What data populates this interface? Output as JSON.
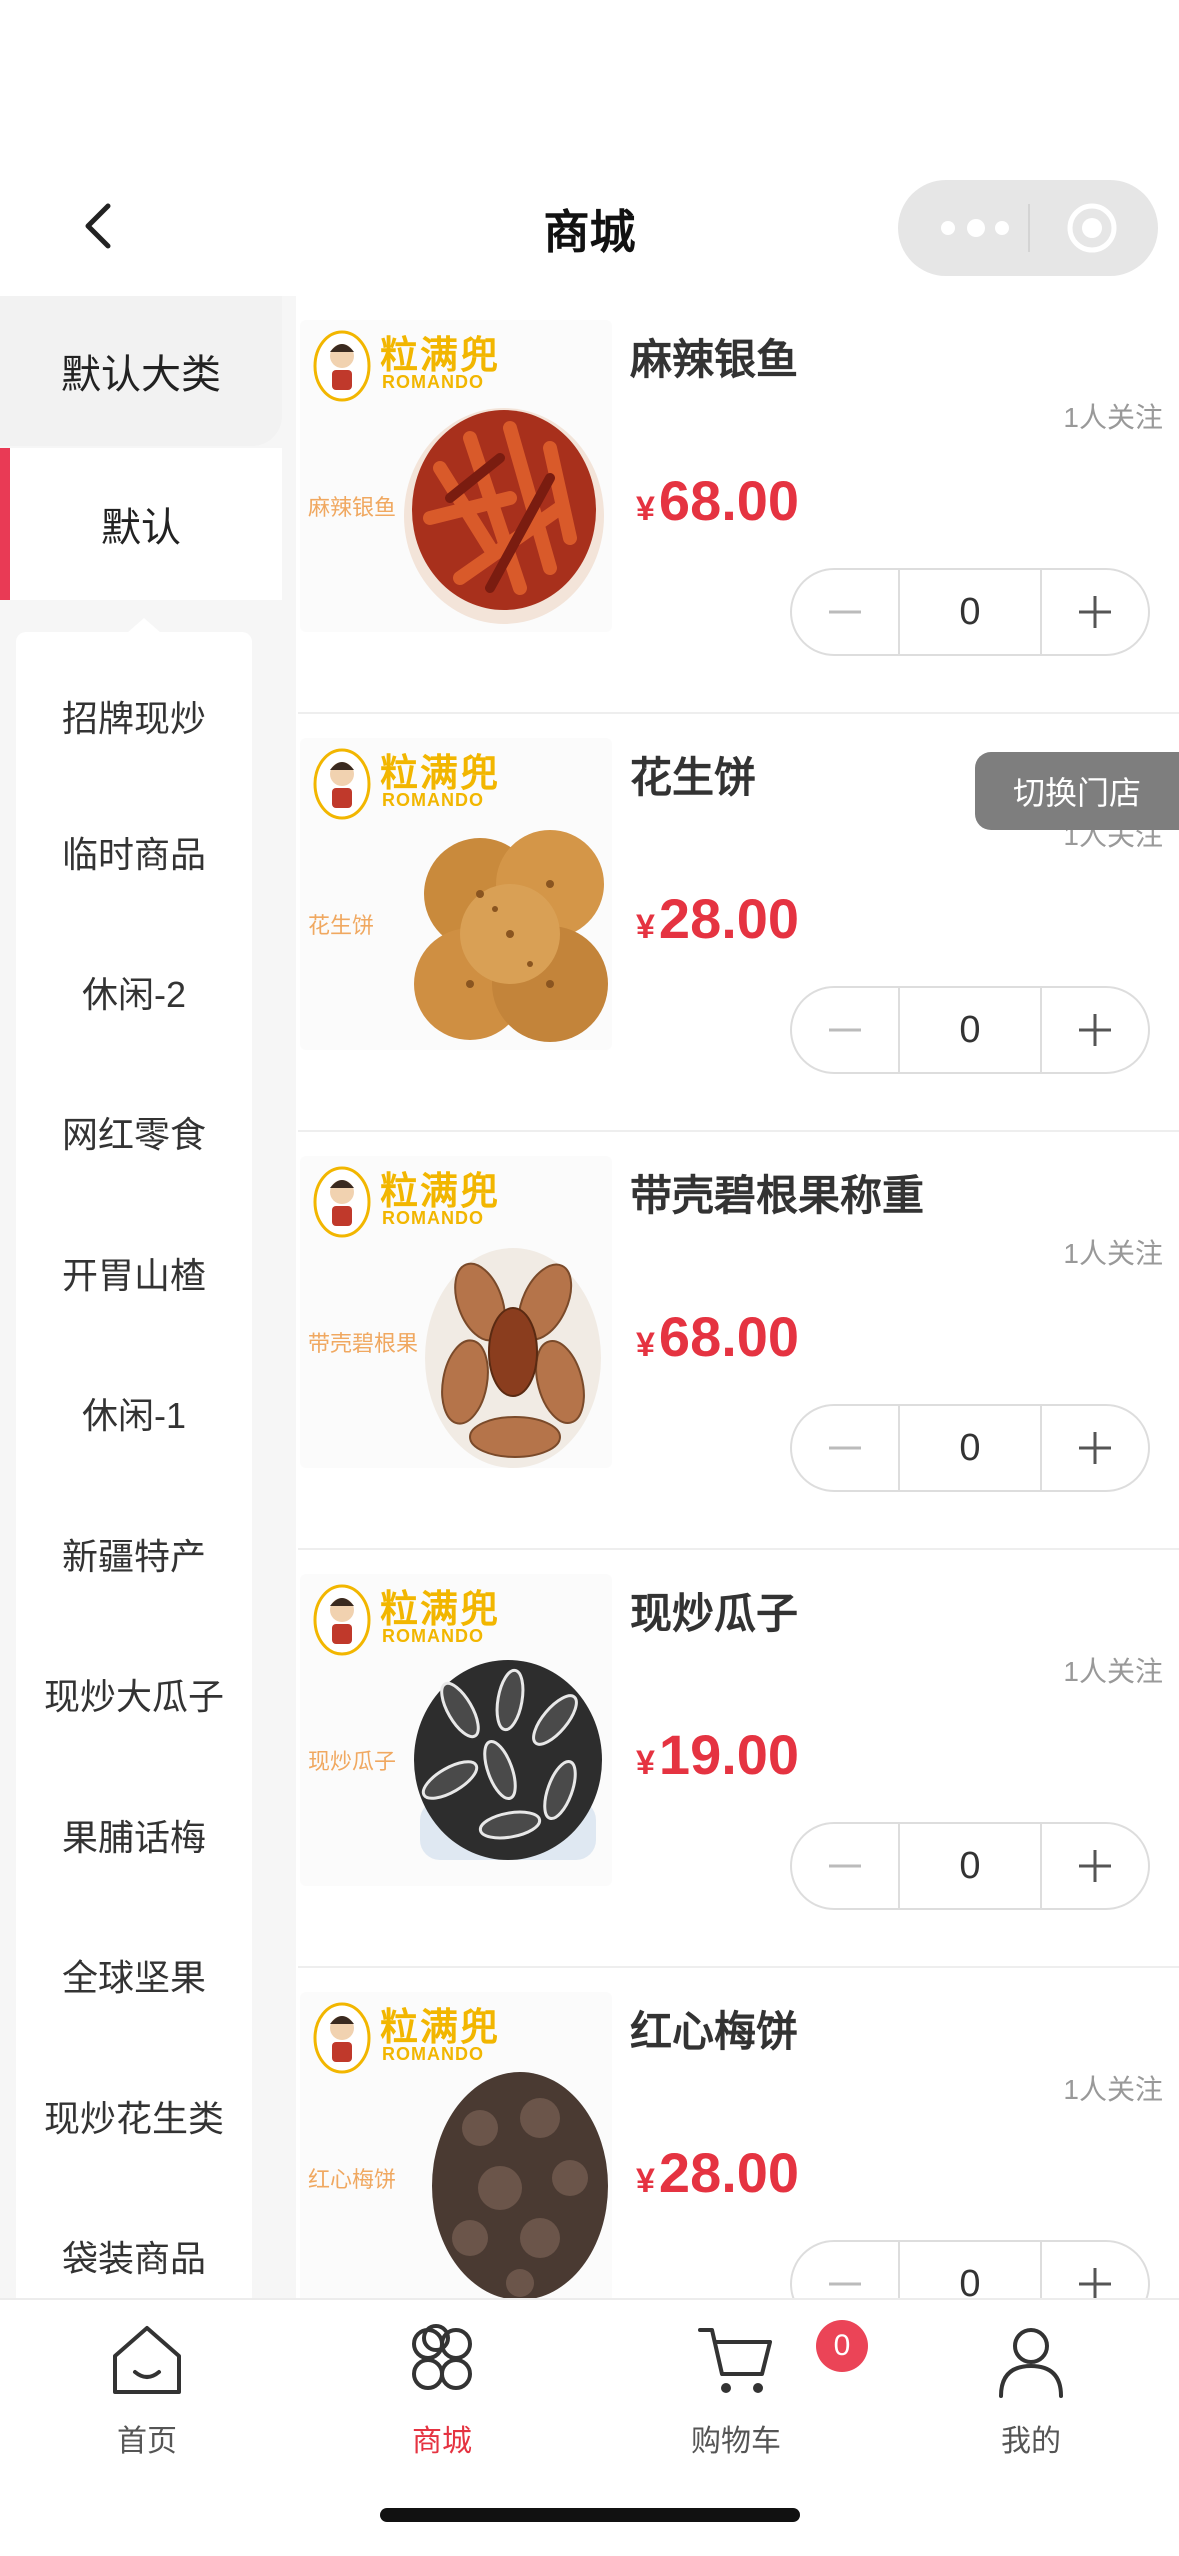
{
  "header": {
    "title": "商城"
  },
  "sidebar": {
    "main_category": "默认大类",
    "selected_category": "默认",
    "sub_categories": [
      "招牌现炒",
      "临时商品",
      "休闲-2",
      "网红零食",
      "开胃山楂",
      "休闲-1",
      "新疆特产",
      "现炒大瓜子",
      "果脯话梅",
      "全球坚果",
      "现炒花生类",
      "袋装商品"
    ]
  },
  "brand": {
    "name_cn": "粒满兜",
    "name_en": "ROMANDO"
  },
  "products": [
    {
      "name": "麻辣银鱼",
      "follow": "1人关注",
      "currency": "¥",
      "price": "68.00",
      "qty": "0",
      "image_label": "麻辣银鱼"
    },
    {
      "name": "花生饼",
      "follow": "1人关注",
      "currency": "¥",
      "price": "28.00",
      "qty": "0",
      "image_label": "花生饼"
    },
    {
      "name": "带壳碧根果称重",
      "follow": "1人关注",
      "currency": "¥",
      "price": "68.00",
      "qty": "0",
      "image_label": "带壳碧根果"
    },
    {
      "name": "现炒瓜子",
      "follow": "1人关注",
      "currency": "¥",
      "price": "19.00",
      "qty": "0",
      "image_label": "现炒瓜子"
    },
    {
      "name": "红心梅饼",
      "follow": "1人关注",
      "currency": "¥",
      "price": "28.00",
      "qty": "0",
      "image_label": "红心梅饼"
    }
  ],
  "switch_store": "切换门店",
  "tabbar": {
    "home": "首页",
    "mall": "商城",
    "cart": "购物车",
    "me": "我的",
    "cart_badge": "0"
  },
  "colors": {
    "accent": "#e53341",
    "brand_yellow": "#f2b600",
    "sidebar_bg": "#f6f6f6",
    "active_bar": "#e93a55"
  }
}
